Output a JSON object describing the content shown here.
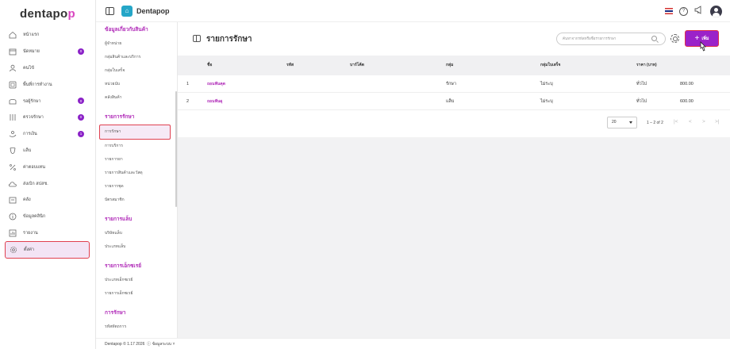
{
  "brand": {
    "logo_prefix": "dentapo",
    "logo_suffix": "p"
  },
  "header": {
    "app_title": "Dentapop"
  },
  "sidebar": {
    "items": [
      {
        "label": "หน้าแรก",
        "icon": "home-icon"
      },
      {
        "label": "นัดหมาย",
        "icon": "calendar-icon",
        "badge": "0"
      },
      {
        "label": "คนไข้",
        "icon": "person-icon"
      },
      {
        "label": "พื้นที่การทำงาน",
        "icon": "workspace-icon"
      },
      {
        "label": "รอผู้รักษา",
        "icon": "waiting-icon",
        "badge": "0"
      },
      {
        "label": "ตรวจรักษา",
        "icon": "treatment-icon",
        "badge": "0"
      },
      {
        "label": "การเงิน",
        "icon": "finance-icon",
        "badge": "1"
      },
      {
        "label": "แล็บ",
        "icon": "lab-icon"
      },
      {
        "label": "ค่าตอบแทน",
        "icon": "percent-icon"
      },
      {
        "label": "ส่งเบิก สปสช.",
        "icon": "cloud-icon"
      },
      {
        "label": "คลัง",
        "icon": "inventory-icon"
      },
      {
        "label": "ข้อมูลคลินิก",
        "icon": "info-icon"
      },
      {
        "label": "รายงาน",
        "icon": "report-icon"
      },
      {
        "label": "ตั้งค่า",
        "icon": "settings-icon"
      }
    ]
  },
  "subnav": {
    "sections": [
      {
        "title": "ข้อมูลเกี่ยวกับสินค้า",
        "items": [
          "ผู้จำหน่าย",
          "กลุ่มสินค้าและบริการ",
          "กลุ่มใบเสร็จ",
          "หน่วยนับ",
          "คลังสินค้า"
        ]
      },
      {
        "title": "รายการรักษา",
        "items": [
          "การรักษา",
          "การบริการ",
          "รายการยา",
          "รายการสินค้าและวัสดุ",
          "รายการชุด",
          "บัตรสมาชิก"
        ]
      },
      {
        "title": "รายการแล็บ",
        "items": [
          "บริษัทแล็บ",
          "ประเภทแล็บ"
        ]
      },
      {
        "title": "รายการเอ็กซเรย์",
        "items": [
          "ประเภทเอ็กซเรย์",
          "รายการเอ็กซเรย์"
        ]
      },
      {
        "title": "การรักษา",
        "items": [
          "รหัสหัตถการ"
        ]
      }
    ]
  },
  "page": {
    "title": "รายการรักษา",
    "search_placeholder": "ค้นหาจากรหัสหรือชื่อรายการรักษา",
    "add_label": "เพิ่ม"
  },
  "table": {
    "columns": [
      "ชื่อ",
      "รหัส",
      "บาร์โค้ด",
      "กลุ่ม",
      "กลุ่มใบเสร็จ",
      "ราคา (บาท)"
    ],
    "rows": [
      {
        "no": "1",
        "name": "ถอนฟันคุด",
        "code": "",
        "barcode": "",
        "group": "รักษา",
        "receipt_group": "ไม่ระบุ",
        "price_type": "ทั่วไป",
        "price": "800.00"
      },
      {
        "no": "2",
        "name": "ถอนฟันผุ",
        "code": "",
        "barcode": "",
        "group": "แล็บ",
        "receipt_group": "ไม่ระบุ",
        "price_type": "ทั่วไป",
        "price": "600.00"
      }
    ]
  },
  "pagination": {
    "per_page": "20",
    "range": "1 – 2 of 2",
    "first": "|<",
    "prev": "<",
    "next": ">",
    "last": ">|"
  },
  "footer": {
    "text": "Dentapop © 1.17 2026",
    "status": "ข้อมูลระบบ"
  },
  "colors": {
    "accent": "#9b22c9",
    "accent_text": "#b02ab8",
    "highlight": "#e0304a"
  }
}
